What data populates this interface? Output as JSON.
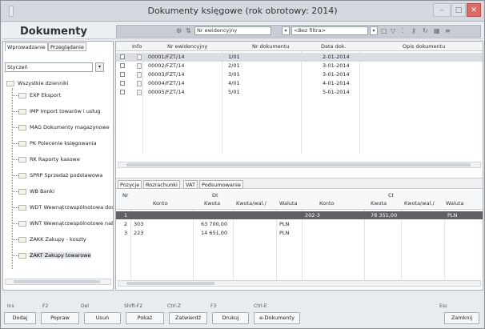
{
  "window": {
    "title": "Dokumenty księgowe (rok obrotowy: 2014)",
    "minimize": "–",
    "maximize": "□",
    "close": "✕"
  },
  "header": {
    "title": "Dokumenty",
    "sort_field": "Nr ewidencyjny",
    "filter_value": "<Bez filtra>",
    "search_value": ""
  },
  "left_panel": {
    "tabs": [
      "Wprowadzanie",
      "Przeglądanie"
    ],
    "month": "Styczeń",
    "root": "Wszystkie dzienniki",
    "journals": [
      "EXP Eksport",
      "IMP Import towarów i usług",
      "MAG Dokumenty magazynowe",
      "PK Polecenie księgowania",
      "RK Raporty kasowe",
      "SPRP Sprzedaż podstawowa",
      "WB Banki",
      "WDT Wewnątrzwspólnotowa dostawa",
      "WNT Wewnątrzwspólnotowe nabycie",
      "ZAKK Zakupy - koszty",
      "ZAKT Zakupy towarowe"
    ],
    "selected_journal": 10
  },
  "documents": {
    "columns": [
      "Info",
      "Nr ewidencyjny",
      "Nr dokumentu",
      "Data dok.",
      "Opis dokumentu"
    ],
    "rows": [
      {
        "nr_ewid": "00001/FZT/14",
        "nr_dok": "1/01",
        "data": "2-01-2014"
      },
      {
        "nr_ewid": "00002/FZT/14",
        "nr_dok": "2/01",
        "data": "3-01-2014"
      },
      {
        "nr_ewid": "00003/FZT/14",
        "nr_dok": "3/01",
        "data": "3-01-2014"
      },
      {
        "nr_ewid": "00004/FZT/14",
        "nr_dok": "4/01",
        "data": "4-01-2014"
      },
      {
        "nr_ewid": "00005/FZT/14",
        "nr_dok": "5/01",
        "data": "5-01-2014"
      }
    ],
    "selected_row": 0
  },
  "positions": {
    "tabs": [
      "Pozycje",
      "Rozrachunki",
      "VAT",
      "Podsumowanie"
    ],
    "header_nr": "Nr",
    "header_dt": "Dt",
    "header_ct": "Ct",
    "columns_dt": [
      "Konto",
      "Kwota",
      "Kwota/wal./",
      "Waluta"
    ],
    "columns_ct": [
      "Konto",
      "Kwota",
      "Kwota/wal./",
      "Waluta"
    ],
    "rows": [
      {
        "nr": "1",
        "konto_dt": "",
        "kwota_dt": "",
        "kwota_wal_dt": "",
        "waluta_dt": "",
        "konto_ct": "202-3",
        "kwota_ct": "78 351,00",
        "kwota_wal_ct": "",
        "waluta_ct": "PLN"
      },
      {
        "nr": "2",
        "konto_dt": "303",
        "kwota_dt": "63 700,00",
        "kwota_wal_dt": "",
        "waluta_dt": "PLN",
        "konto_ct": "",
        "kwota_ct": "",
        "kwota_wal_ct": "",
        "waluta_ct": ""
      },
      {
        "nr": "3",
        "konto_dt": "223",
        "kwota_dt": "14 651,00",
        "kwota_wal_dt": "",
        "waluta_dt": "PLN",
        "konto_ct": "",
        "kwota_ct": "",
        "kwota_wal_ct": "",
        "waluta_ct": ""
      }
    ]
  },
  "footer": {
    "keys": [
      "Ins",
      "F2",
      "Del",
      "Shift-F2",
      "Ctrl-Z",
      "F3",
      "Ctrl-E",
      "Esc"
    ],
    "buttons": [
      "Dodaj",
      "Popraw",
      "Usuń",
      "Pokaż",
      "Zatwierdź",
      "Drukuj",
      "e-Dokumenty",
      "Zamknij"
    ]
  }
}
